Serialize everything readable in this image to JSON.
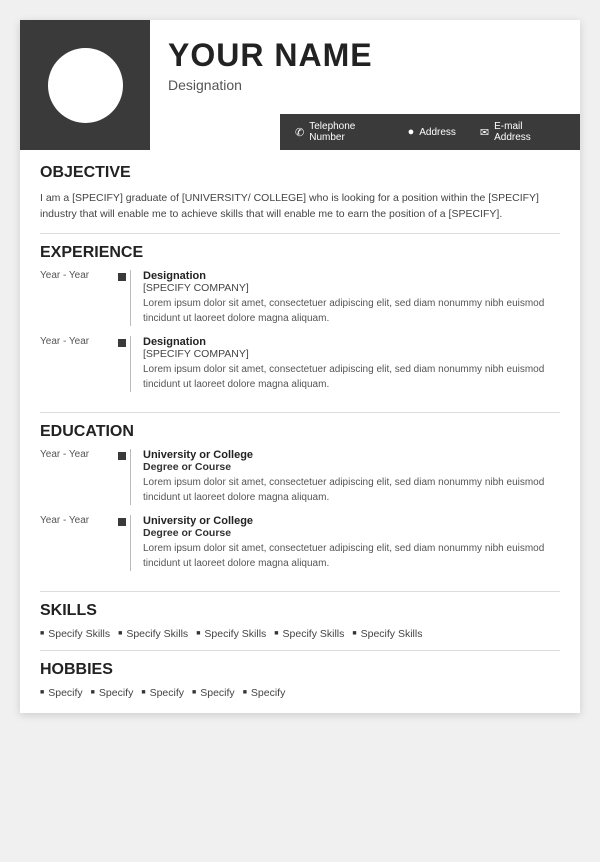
{
  "header": {
    "name": "YOUR NAME",
    "designation": "Designation",
    "contact": {
      "phone": "Telephone Number",
      "address": "Address",
      "email": "E-mail Address"
    }
  },
  "sections": {
    "objective": {
      "title": "OBJECTIVE",
      "text": "I am a [SPECIFY] graduate of [UNIVERSITY/ COLLEGE] who is looking for a position within the [SPECIFY] industry that will enable me to achieve skills that will enable me to earn the position of a [SPECIFY]."
    },
    "experience": {
      "title": "EXPERIENCE",
      "items": [
        {
          "years": "Year - Year",
          "title": "Designation",
          "company": "[SPECIFY COMPANY]",
          "desc": "Lorem ipsum dolor sit amet, consectetuer adipiscing elit, sed diam nonummy nibh euismod tincidunt ut laoreet dolore magna aliquam."
        },
        {
          "years": "Year - Year",
          "title": "Designation",
          "company": "[SPECIFY COMPANY]",
          "desc": "Lorem ipsum dolor sit amet, consectetuer adipiscing elit, sed diam nonummy nibh euismod tincidunt ut laoreet dolore magna aliquam."
        }
      ]
    },
    "education": {
      "title": "EDUCATION",
      "items": [
        {
          "years": "Year - Year",
          "uni": "University or College",
          "degree": "Degree or Course",
          "desc": "Lorem ipsum dolor sit amet, consectetuer adipiscing elit, sed diam nonummy nibh euismod tincidunt ut laoreet dolore magna aliquam."
        },
        {
          "years": "Year - Year",
          "uni": "University or College",
          "degree": "Degree or Course",
          "desc": "Lorem ipsum dolor sit amet, consectetuer adipiscing elit, sed diam nonummy nibh euismod tincidunt ut laoreet dolore magna aliquam."
        }
      ]
    },
    "skills": {
      "title": "SKILLS",
      "items": [
        "Specify Skills",
        "Specify Skills",
        "Specify Skills",
        "Specify Skills",
        "Specify Skills"
      ]
    },
    "hobbies": {
      "title": "HOBBIES",
      "items": [
        "Specify",
        "Specify",
        "Specify",
        "Specify",
        "Specify"
      ]
    }
  }
}
